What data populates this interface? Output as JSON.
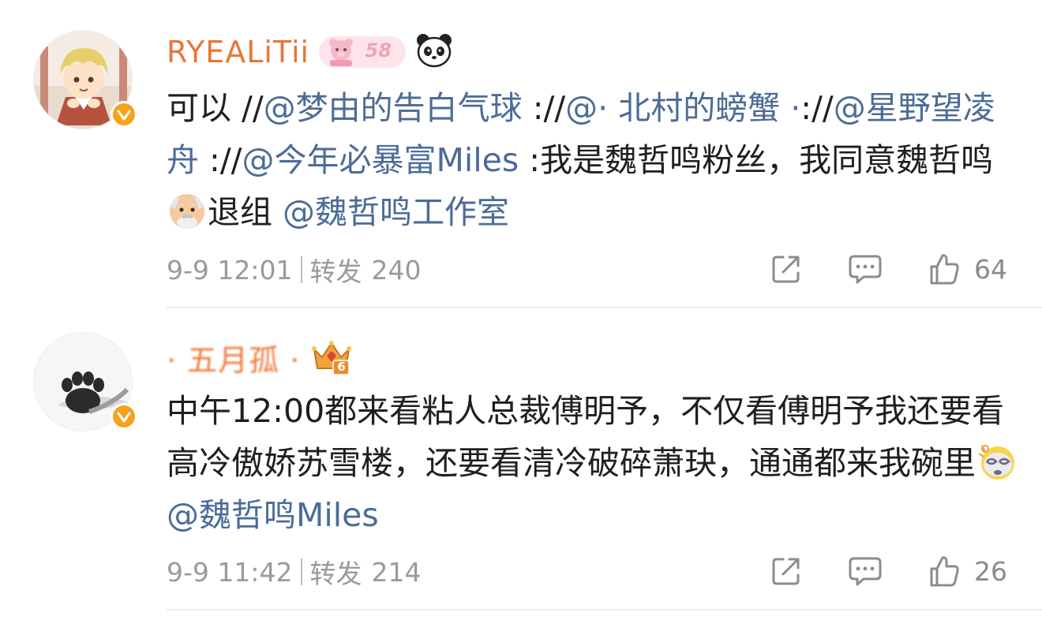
{
  "posts": [
    {
      "username": "RYEALiTii",
      "level_badge": "58",
      "content": {
        "t1": "可以 //",
        "m1": "@梦由的告白气球",
        "t2": " ://",
        "m2": "@· 北村的螃蟹 ·",
        "t3": "://",
        "m3": "@星野望凌舟",
        "t4": " ://",
        "m4": "@今年必暴富Miles",
        "t5": " :我是魏哲鸣粉丝，我同意魏哲鸣",
        "t6": "退组 ",
        "m5": "@魏哲鸣工作室"
      },
      "time": "9-9 12:01",
      "repost_label": "转发",
      "repost_count": "240",
      "like_count": "64",
      "icons": [
        "share-icon",
        "comment-icon",
        "like-icon",
        "old-man-emoji",
        "panda-icon",
        "verified-icon"
      ]
    },
    {
      "username": "· 五月孤 ·",
      "level_badge": "6",
      "content": {
        "t1": "中午12:00都来看粘人总裁傅明予，不仅看傅明予我还要看高冷傲娇苏雪楼，还要看清冷破碎萧玦，通通都来我碗里",
        "m1": "@魏哲鸣Miles"
      },
      "time": "9-9 11:42",
      "repost_label": "转发",
      "repost_count": "214",
      "like_count": "26",
      "icons": [
        "share-icon",
        "comment-icon",
        "like-icon",
        "dizzy-face-emoji",
        "crown-badge-icon",
        "verified-icon"
      ]
    }
  ],
  "colors": {
    "username_orange": "#e8763a",
    "mention_blue": "#4c6c97",
    "meta_gray": "#9a9a9a",
    "verified_orange": "#f7a21b"
  }
}
